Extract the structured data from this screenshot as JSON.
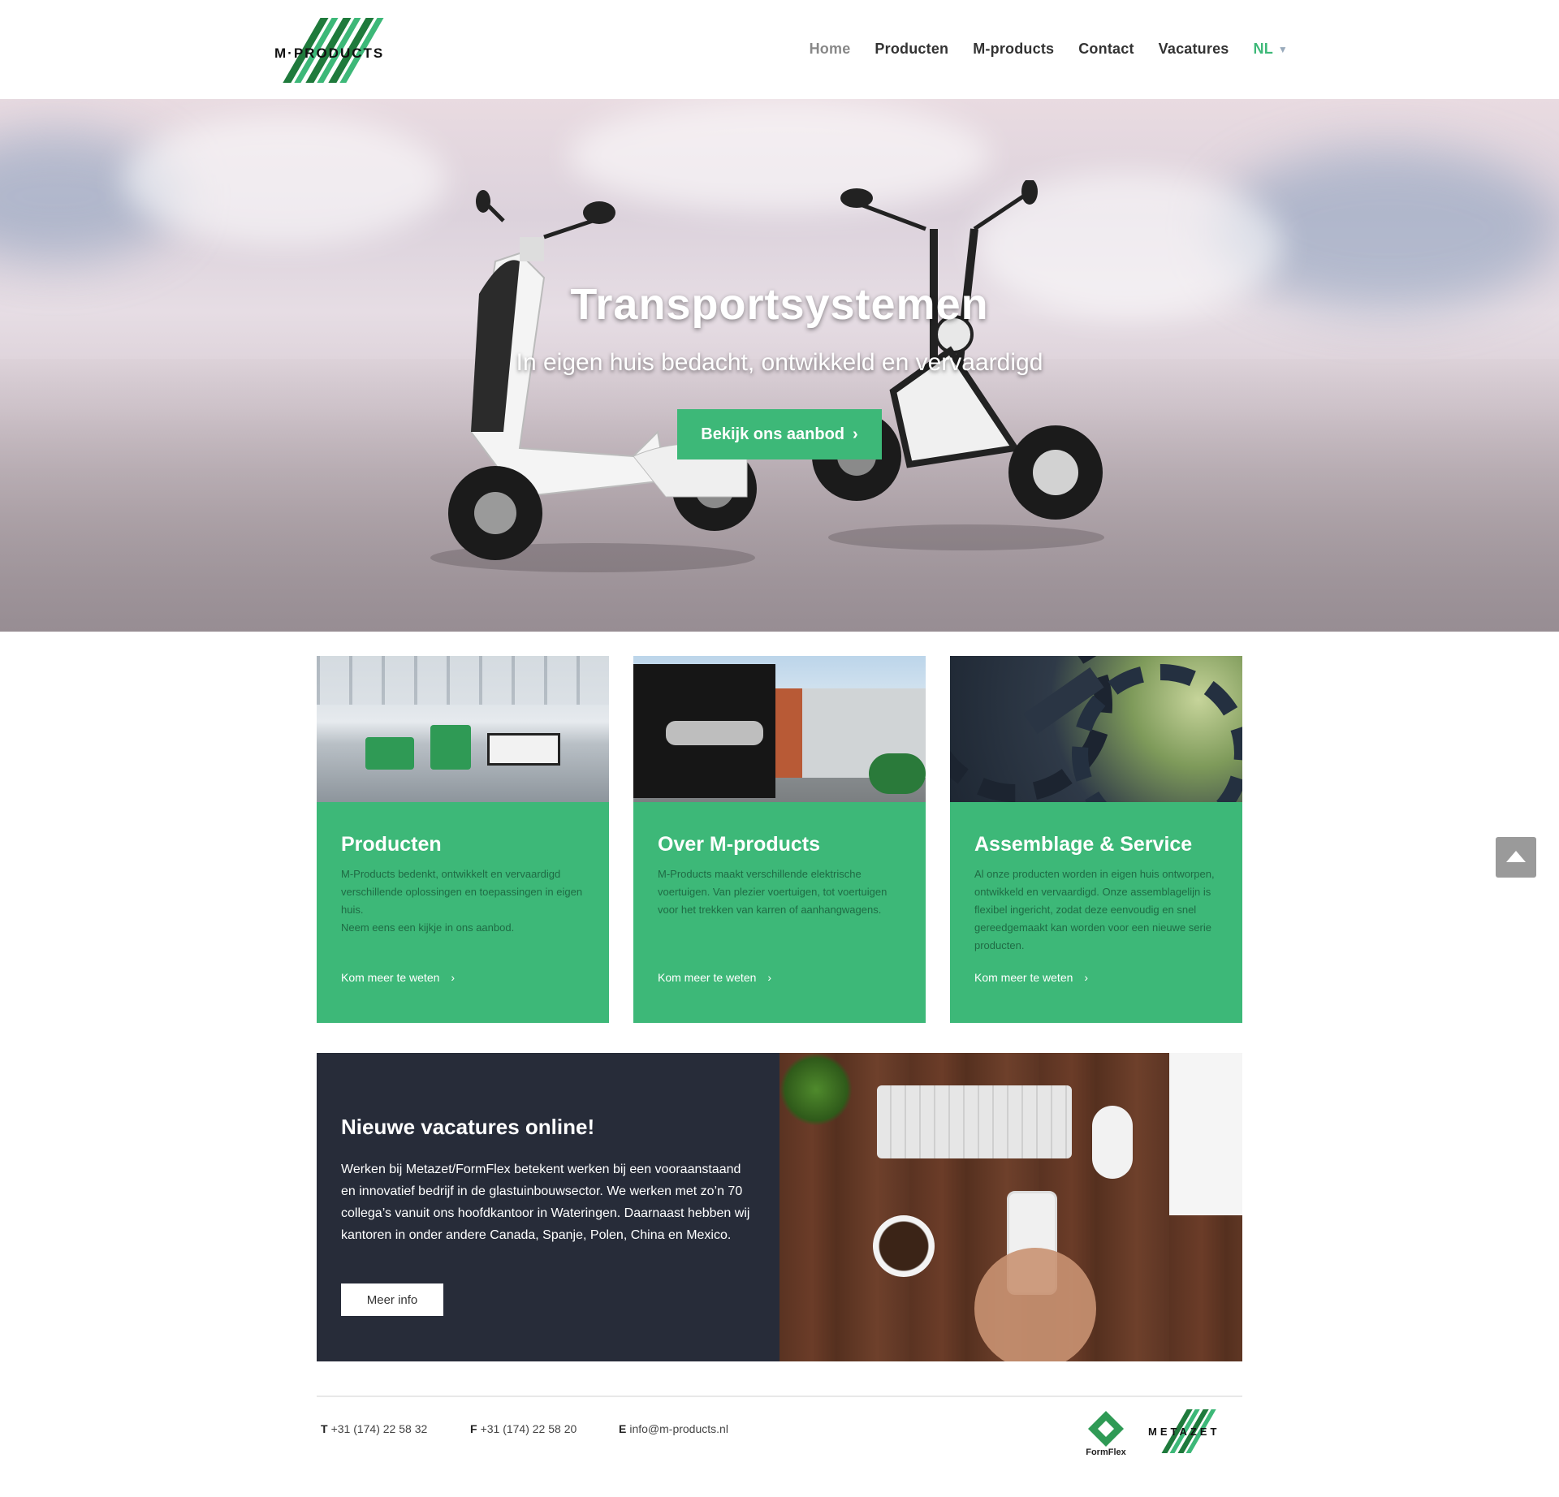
{
  "brand": {
    "logo_text": "M·PRODUCTS",
    "accent": "#3db878",
    "dark": "#272c39"
  },
  "nav": {
    "items": [
      {
        "label": "Home",
        "active": true
      },
      {
        "label": "Producten"
      },
      {
        "label": "M-products"
      },
      {
        "label": "Contact"
      },
      {
        "label": "Vacatures"
      }
    ],
    "lang": "NL"
  },
  "hero": {
    "title": "Transportsystemen",
    "subtitle": "In eigen huis bedacht, ontwikkeld en vervaardigd",
    "button": "Bekijk ons aanbod"
  },
  "cards": [
    {
      "title": "Producten",
      "text": "M-Products bedenkt, ontwikkelt en vervaardigd verschillende oplossingen en toepassingen in eigen huis.\nNeem eens een kijkje in ons aanbod.",
      "link": "Kom meer te weten"
    },
    {
      "title": "Over M-products",
      "text": "M-Products maakt verschillende elektrische voertuigen. Van plezier voertuigen, tot voertuigen voor het trekken van karren of aanhangwagens.",
      "link": "Kom meer te weten"
    },
    {
      "title": "Assemblage & Service",
      "text": "Al onze producten worden in eigen huis ontworpen, ontwikkeld en vervaardigd. Onze assemblagelijn is flexibel ingericht, zodat deze eenvoudig en snel gereedgemaakt kan worden voor een nieuwe serie producten.",
      "link": "Kom meer te weten"
    }
  ],
  "vacatures": {
    "title": "Nieuwe vacatures online!",
    "text": "Werken bij Metazet/FormFlex betekent werken bij een vooraanstaand en innovatief bedrijf in de glastuinbouwsector. We werken met zo’n 70 collega’s vanuit ons hoofdkantoor in Wateringen. Daarnaast hebben wij kantoren in onder andere Canada, Spanje, Polen, China en Mexico.",
    "button": "Meer info"
  },
  "footer": {
    "phone_label": "T",
    "phone": "+31 (174) 22 58 32",
    "fax_label": "F",
    "fax": "+31 (174) 22 58 20",
    "email_label": "E",
    "email": "info@m-products.nl",
    "partner_logos": [
      "FormFlex",
      "METAZET"
    ]
  }
}
